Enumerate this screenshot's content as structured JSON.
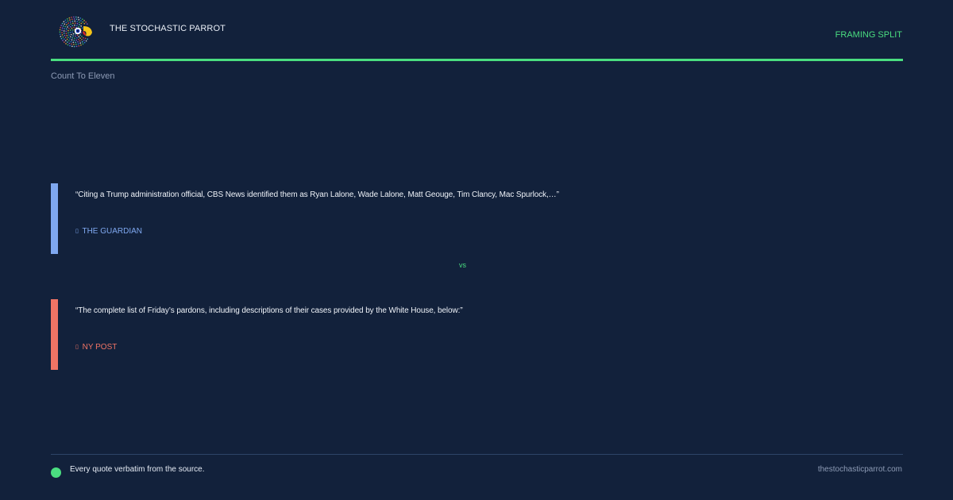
{
  "brand": {
    "name": "THE STOCHASTIC PARROT",
    "logo_icon": "parrot-logo-icon"
  },
  "badge": "FRAMING SPLIT",
  "subtitle": "Count To Eleven",
  "colors": {
    "background": "#12213b",
    "accent": "#4ade80",
    "guardian": "#7fa8f0",
    "nypost": "#f07465"
  },
  "quotes": [
    {
      "text": "“Citing a Trump administration official, CBS News identified them as Ryan Lalone, Wade Lalone, Matt Geouge, Tim Clancy, Mac Spurlock,…”",
      "source": "THE GUARDIAN",
      "source_icon": "source-icon"
    },
    {
      "text": "“The complete list of Friday’s pardons, including descriptions of their cases provided by the White House, below:”",
      "source": "NY POST",
      "source_icon": "source-icon"
    }
  ],
  "vs_label": "vs",
  "footer": {
    "note": "Every quote verbatim from the source.",
    "url": "thestochasticparrot.com"
  }
}
